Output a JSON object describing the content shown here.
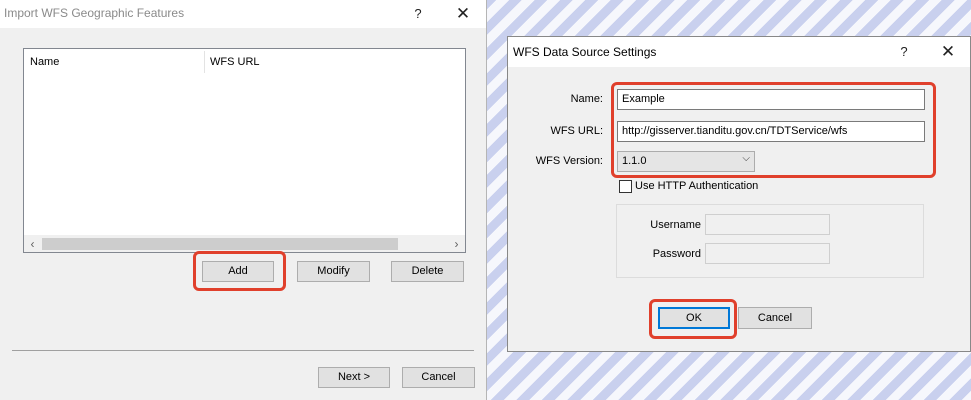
{
  "import_dialog": {
    "title": "Import WFS Geographic Features",
    "help_glyph": "?",
    "close_glyph": "✕",
    "list": {
      "columns": [
        "Name",
        "WFS URL"
      ],
      "scroll_left": "‹",
      "scroll_right": "›"
    },
    "buttons": {
      "add": "Add",
      "modify": "Modify",
      "delete": "Delete",
      "next": "Next >",
      "cancel": "Cancel"
    }
  },
  "settings_dialog": {
    "title": "WFS Data Source Settings",
    "help_glyph": "?",
    "close_glyph": "✕",
    "fields": {
      "name_label": "Name:",
      "name_value": "Example",
      "url_label": "WFS URL:",
      "url_value": "http://gisserver.tianditu.gov.cn/TDTService/wfs",
      "version_label": "WFS Version:",
      "version_value": "1.1.0",
      "version_arrow": "⌵"
    },
    "auth": {
      "checkbox_label": "Use HTTP Authentication",
      "checked": false,
      "username_label": "Username",
      "password_label": "Password"
    },
    "buttons": {
      "ok": "OK",
      "cancel": "Cancel"
    }
  },
  "colors": {
    "highlight": "#e0402c",
    "focus_border": "#0078d7",
    "background_stripe": "#c9d0ee"
  }
}
